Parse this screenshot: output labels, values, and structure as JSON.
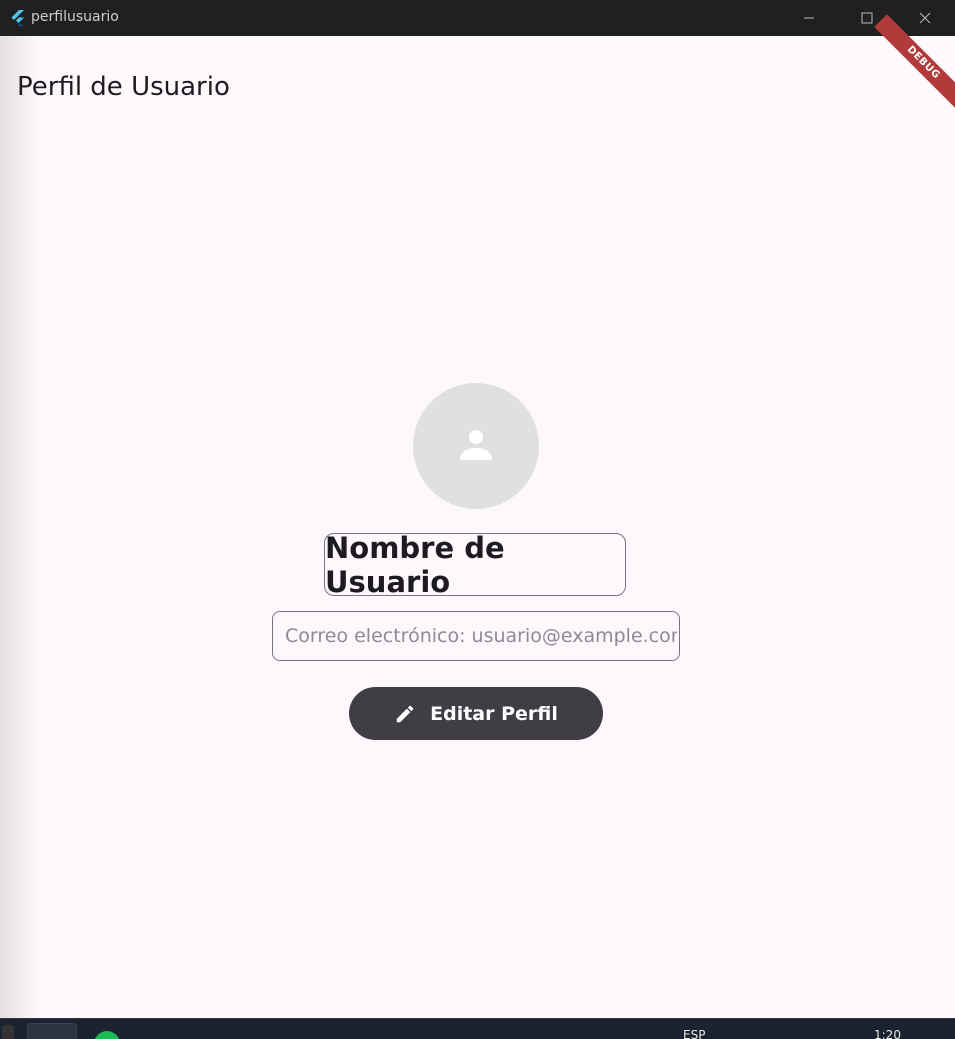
{
  "window": {
    "title": "perfilusuario",
    "controls": [
      "minimize-icon",
      "maximize-icon",
      "close-icon"
    ]
  },
  "appbar": {
    "title": "Perfil de Usuario",
    "debug_banner": "DEBUG"
  },
  "profile": {
    "avatar_icon": "person-icon",
    "name": "Nombre de Usuario",
    "email_placeholder": "Correo electrónico: usuario@example.com",
    "email_value": "",
    "edit_button_label": "Editar Perfil",
    "edit_button_icon": "pencil-icon"
  },
  "taskbar": {
    "language": "ESP",
    "clock": "1:20"
  },
  "colors": {
    "background": "#fdf8fb",
    "titlebar": "#202020",
    "avatar": "#e0e0e0",
    "button": "#403d44",
    "border": "#79747e",
    "debug": "#b13b3b"
  }
}
